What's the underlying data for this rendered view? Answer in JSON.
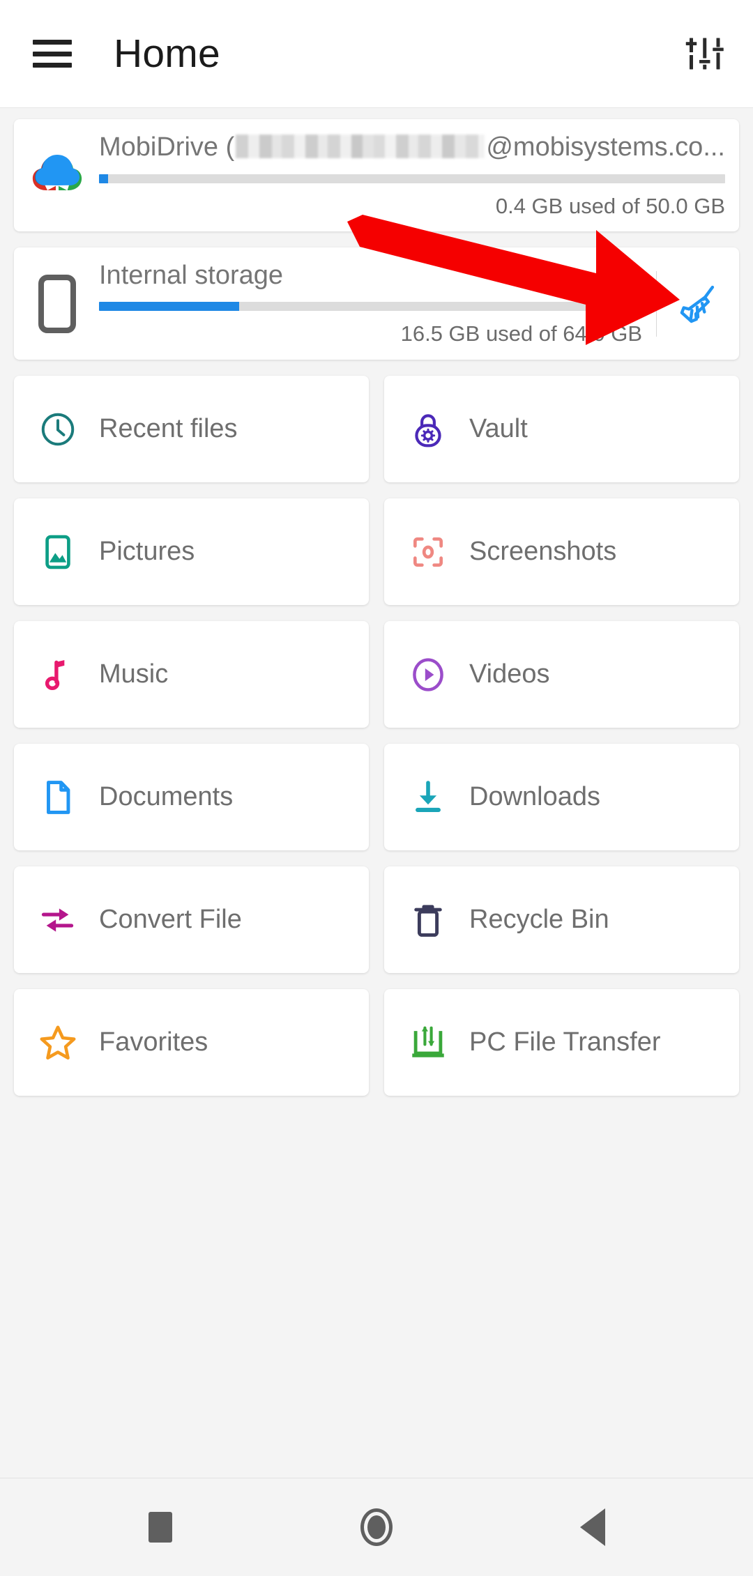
{
  "header": {
    "title": "Home",
    "menu_icon": "hamburger-menu-icon",
    "settings_icon": "tune-sliders-icon"
  },
  "storage": [
    {
      "name_prefix": "MobiDrive (",
      "name_suffix": "@mobisystems.co...",
      "account_masked": true,
      "usage": "0.4 GB used of 50.0 GB",
      "percent": 0.8,
      "icon": "mobidrive-cloud-icon",
      "has_clean_button": false
    },
    {
      "name_prefix": "Internal storage",
      "name_suffix": "",
      "account_masked": false,
      "usage": "16.5 GB used of 64.0 GB",
      "percent": 25.8,
      "icon": "phone-device-icon",
      "has_clean_button": true,
      "clean_icon": "broom-clean-icon"
    }
  ],
  "tiles": [
    {
      "label": "Recent files",
      "icon": "clock-icon",
      "color": "#1b7b7b"
    },
    {
      "label": "Vault",
      "icon": "lock-icon",
      "color": "#4b29b8"
    },
    {
      "label": "Pictures",
      "icon": "image-icon",
      "color": "#0d9e86"
    },
    {
      "label": "Screenshots",
      "icon": "screenshot-icon",
      "color": "#ef8882"
    },
    {
      "label": "Music",
      "icon": "music-note-icon",
      "color": "#e8196e"
    },
    {
      "label": "Videos",
      "icon": "play-circle-icon",
      "color": "#9b4dca"
    },
    {
      "label": "Documents",
      "icon": "document-icon",
      "color": "#2196f3"
    },
    {
      "label": "Downloads",
      "icon": "download-icon",
      "color": "#1aa5b8"
    },
    {
      "label": "Convert File",
      "icon": "convert-arrows-icon",
      "color": "#b4168c"
    },
    {
      "label": "Recycle Bin",
      "icon": "trash-icon",
      "color": "#3c3c5c"
    },
    {
      "label": "Favorites",
      "icon": "star-icon",
      "color": "#f59a1e"
    },
    {
      "label": "PC File Transfer",
      "icon": "pc-transfer-icon",
      "color": "#3aa83a"
    }
  ],
  "navbar": {
    "recents_label": "recents-square-icon",
    "home_label": "home-circle-icon",
    "back_label": "back-triangle-icon"
  },
  "annotation": {
    "arrow_color": "#f50000",
    "points_at": "broom-clean-icon"
  },
  "colors": {
    "accent_blue": "#1e88e5",
    "background": "#f4f4f4",
    "card": "#ffffff",
    "text_primary": "#1b1b1b",
    "text_secondary": "#6e6e6e"
  }
}
